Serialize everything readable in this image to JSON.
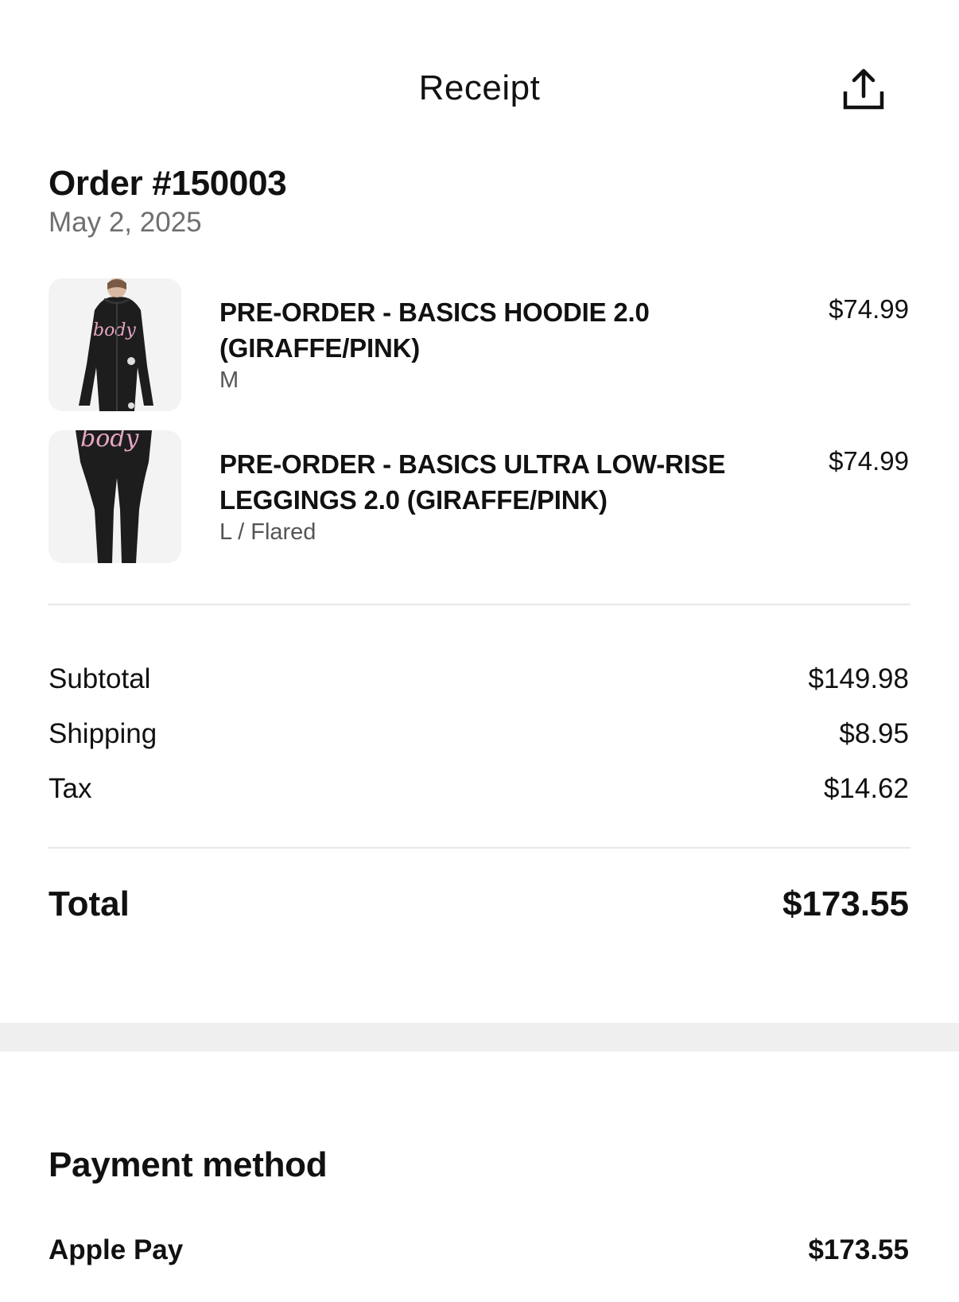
{
  "header": {
    "title": "Receipt",
    "share_icon": "share-icon"
  },
  "order": {
    "title": "Order #150003",
    "date": "May 2, 2025"
  },
  "items": [
    {
      "name": "PRE-ORDER - BASICS HOODIE 2.0 (GIRAFFE/PINK)",
      "variant": "M",
      "price": "$74.99",
      "image_text": "body"
    },
    {
      "name": "PRE-ORDER - BASICS ULTRA LOW-RISE LEGGINGS 2.0 (GIRAFFE/PINK)",
      "variant": "L / Flared",
      "price": "$74.99",
      "image_text": "body"
    }
  ],
  "summary": {
    "subtotal_label": "Subtotal",
    "subtotal_value": "$149.98",
    "shipping_label": "Shipping",
    "shipping_value": "$8.95",
    "tax_label": "Tax",
    "tax_value": "$14.62"
  },
  "total": {
    "label": "Total",
    "value": "$173.55"
  },
  "payment": {
    "title": "Payment method",
    "method": "Apple Pay",
    "amount": "$173.55"
  }
}
